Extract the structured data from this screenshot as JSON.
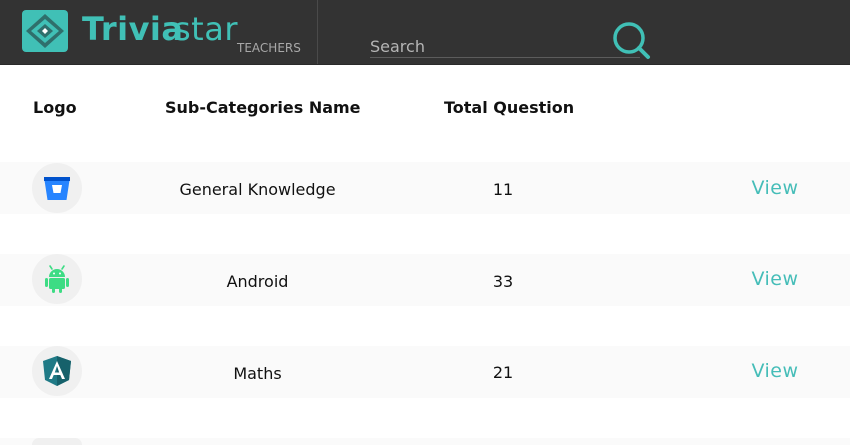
{
  "header": {
    "brand_strong": "Trivia",
    "brand_light": "star",
    "brand_sub": "TEACHERS",
    "search_placeholder": "Search",
    "accent_color": "#40c0b6"
  },
  "table": {
    "columns": {
      "logo": "Logo",
      "name": "Sub-Categories Name",
      "total": "Total Question"
    },
    "rows": [
      {
        "icon": "bitbucket-icon",
        "name": "General Knowledge",
        "count": "11",
        "action": "View"
      },
      {
        "icon": "android-icon",
        "name": "Android",
        "count": "33",
        "action": "View"
      },
      {
        "icon": "angular-icon",
        "name": "Maths",
        "count": "21",
        "action": "View"
      }
    ]
  }
}
